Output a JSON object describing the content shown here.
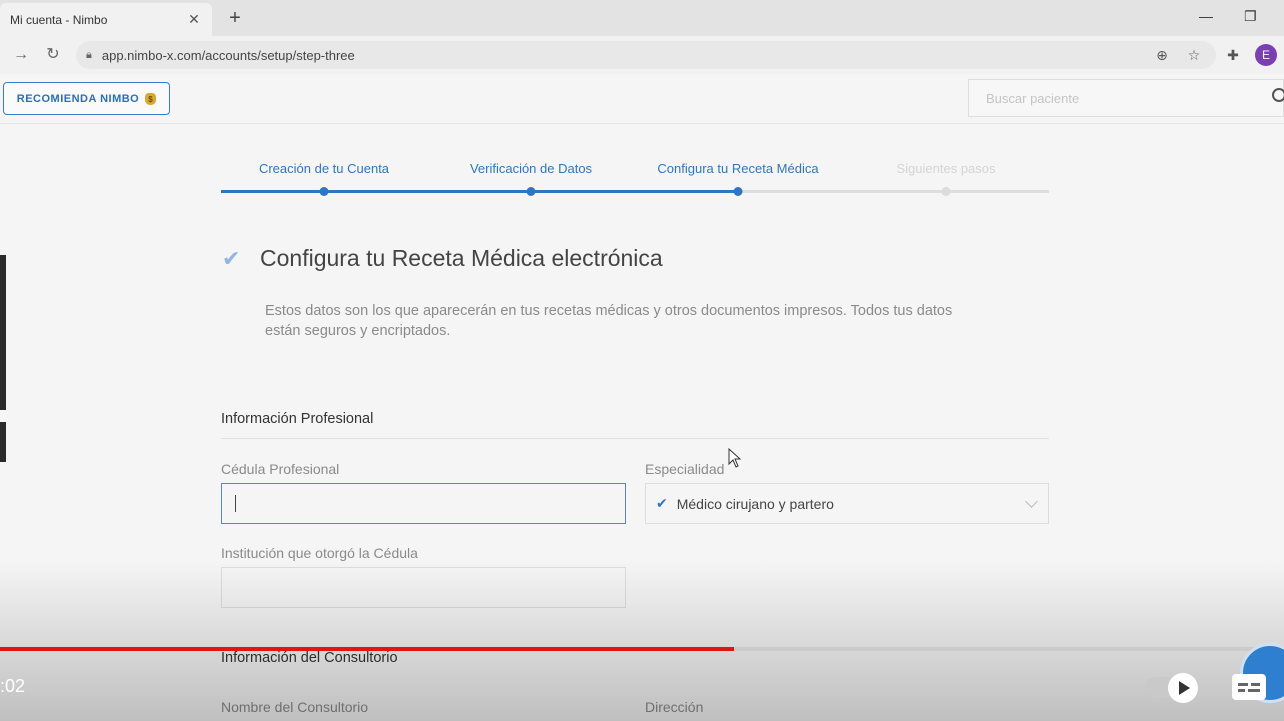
{
  "browser": {
    "tab_title": "Mi cuenta - Nimbo",
    "tab_close": "✕",
    "new_tab": "+",
    "url": "app.nimbo-x.com/accounts/setup/step-three",
    "profile_initial": "E",
    "minimize": "—",
    "restore": "❐"
  },
  "header": {
    "recommend_label": "RECOMIENDA NIMBO",
    "search_placeholder": "Buscar paciente"
  },
  "stepper": {
    "steps": [
      {
        "label": "Creación de tu Cuenta",
        "state": "done"
      },
      {
        "label": "Verificación de Datos",
        "state": "done"
      },
      {
        "label": "Configura tu Receta Médica",
        "state": "current"
      },
      {
        "label": "Siguientes pasos",
        "state": "pending"
      }
    ]
  },
  "page": {
    "title": "Configura tu Receta Médica electrónica",
    "description": "Estos datos son los que aparecerán en tus recetas médicas y otros documentos impresos. Todos tus datos están seguros y encriptados."
  },
  "professional": {
    "section_title": "Información Profesional",
    "cedula_label": "Cédula Profesional",
    "cedula_value": "",
    "especialidad_label": "Especialidad",
    "especialidad_value": "Médico cirujano y partero",
    "institucion_label": "Institución que otorgó la Cédula",
    "institucion_value": ""
  },
  "consultorio": {
    "section_title": "Información del Consultorio",
    "nombre_label": "Nombre del Consultorio",
    "direccion_label": "Dirección"
  },
  "video": {
    "timestamp": ":02",
    "progress": 0.572
  },
  "colors": {
    "accent": "#2f76c2",
    "progress_red": "#e01616",
    "avatar": "#7b3fb5"
  }
}
